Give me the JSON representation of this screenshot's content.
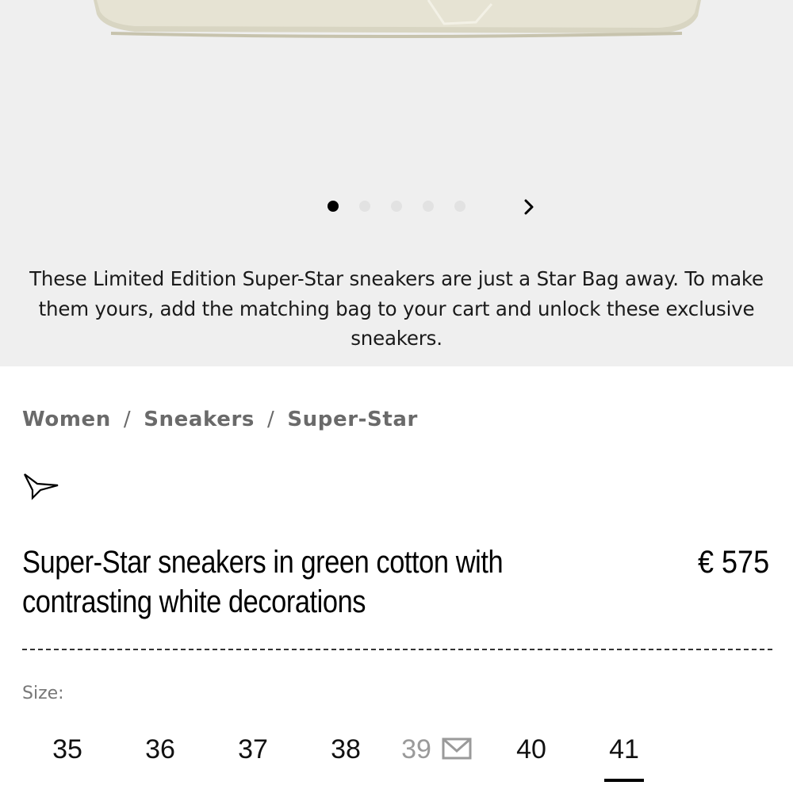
{
  "carousel": {
    "slide_count": 5,
    "active_index": 0,
    "next_icon": "chevron-right-icon"
  },
  "promo_text": "These Limited Edition Super-Star sneakers are just a Star Bag away. To make them yours, add the matching bag to your cart and unlock these exclusive sneakers.",
  "breadcrumb": {
    "items": [
      "Women",
      "Sneakers",
      "Super-Star"
    ],
    "separator": "/"
  },
  "brand_icon": "star-outline-icon",
  "product": {
    "title": "Super-Star sneakers in green cotton with contrasting white decorations",
    "price": "€ 575"
  },
  "sizes": {
    "label": "Size:",
    "options": [
      {
        "value": "35",
        "available": true
      },
      {
        "value": "36",
        "available": true
      },
      {
        "value": "37",
        "available": true
      },
      {
        "value": "38",
        "available": true
      },
      {
        "value": "39",
        "available": false
      },
      {
        "value": "40",
        "available": true
      },
      {
        "value": "41",
        "available": true
      }
    ],
    "selected": "41",
    "notify_icon": "mail-icon"
  },
  "colors": {
    "hero_bg": "#efefef",
    "text": "#111111",
    "muted": "#6a6a6a",
    "unavailable": "#9a9a9a"
  }
}
